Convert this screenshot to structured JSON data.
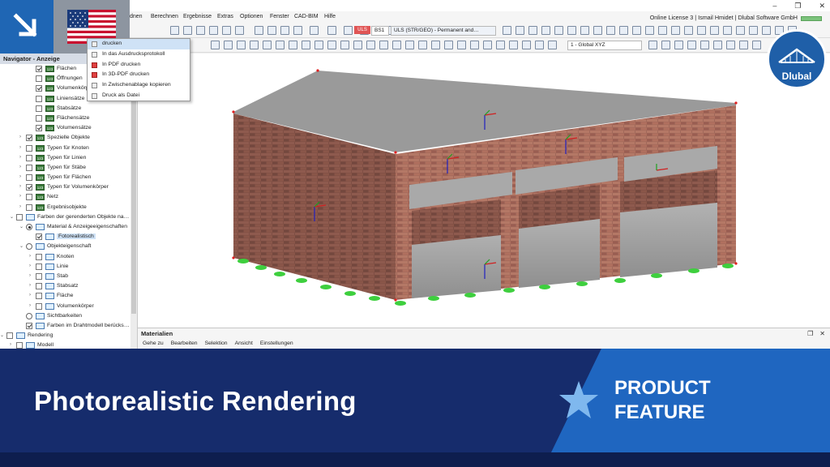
{
  "menu": {
    "items": [
      "dnen",
      "Berechnen",
      "Ergebnisse",
      "Extras",
      "Optionen",
      "Fenster",
      "CAD-BIM",
      "Hilfe"
    ]
  },
  "title_info": "Online License 3 | Ismail Hmidet | Dlubal Software GmbH",
  "toolbar": {
    "load_combo_badge": "ULS",
    "load_combo_id": "BS1",
    "load_combo_label": "ULS (STR/GEO) - Permanent and…",
    "coord_system": "1 - Global XYZ"
  },
  "dropdown": {
    "items": [
      {
        "label": "drucken",
        "selected": true
      },
      {
        "label": "In das Ausdrucksprotokoll",
        "selected": false
      },
      {
        "label": "In PDF drucken",
        "selected": false,
        "icon": "pdf-icon"
      },
      {
        "label": "In 3D-PDF drucken",
        "selected": false,
        "icon": "pdf-icon"
      },
      {
        "label": "In Zwischenablage kopieren",
        "selected": false
      },
      {
        "label": "Druck als Datei",
        "selected": false
      }
    ]
  },
  "navigator": {
    "title": "Navigator - Anzeige",
    "rows": [
      {
        "indent": 3,
        "exp": "",
        "ctrl": "cb",
        "checked": true,
        "icon": "123",
        "label": "Flächen"
      },
      {
        "indent": 3,
        "exp": "",
        "ctrl": "cb",
        "checked": false,
        "icon": "123",
        "label": "Öffnungen"
      },
      {
        "indent": 3,
        "exp": "",
        "ctrl": "cb",
        "checked": true,
        "icon": "123",
        "label": "Volumenkörper"
      },
      {
        "indent": 3,
        "exp": "",
        "ctrl": "cb",
        "checked": false,
        "icon": "123",
        "label": "Liniensätze"
      },
      {
        "indent": 3,
        "exp": "",
        "ctrl": "cb",
        "checked": false,
        "icon": "123",
        "label": "Stabsätze"
      },
      {
        "indent": 3,
        "exp": "",
        "ctrl": "cb",
        "checked": false,
        "icon": "123",
        "label": "Flächensätze"
      },
      {
        "indent": 3,
        "exp": "",
        "ctrl": "cb",
        "checked": true,
        "icon": "123",
        "label": "Volumensätze"
      },
      {
        "indent": 2,
        "exp": "›",
        "ctrl": "cb",
        "checked": true,
        "icon": "123",
        "label": "Spezielle Objekte"
      },
      {
        "indent": 2,
        "exp": "›",
        "ctrl": "cb",
        "checked": false,
        "icon": "123",
        "label": "Typen für Knoten"
      },
      {
        "indent": 2,
        "exp": "›",
        "ctrl": "cb",
        "checked": false,
        "icon": "123",
        "label": "Typen für Linien"
      },
      {
        "indent": 2,
        "exp": "›",
        "ctrl": "cb",
        "checked": false,
        "icon": "123",
        "label": "Typen für Stäbe"
      },
      {
        "indent": 2,
        "exp": "›",
        "ctrl": "cb",
        "checked": false,
        "icon": "123",
        "label": "Typen für Flächen"
      },
      {
        "indent": 2,
        "exp": "›",
        "ctrl": "cb",
        "checked": true,
        "icon": "123",
        "label": "Typen für Volumenkörper"
      },
      {
        "indent": 2,
        "exp": "›",
        "ctrl": "cb",
        "checked": false,
        "icon": "123",
        "label": "Netz"
      },
      {
        "indent": 2,
        "exp": "›",
        "ctrl": "cb",
        "checked": false,
        "icon": "123",
        "label": "Ergebnisobjekte"
      },
      {
        "indent": 1,
        "exp": "⌄",
        "ctrl": "cb",
        "checked": false,
        "icon": "brush",
        "label": "Farben der gerenderten Objekte na…"
      },
      {
        "indent": 2,
        "exp": "⌄",
        "ctrl": "rd",
        "checked": true,
        "icon": "brush",
        "label": "Material & Anzeigeeigenschaften"
      },
      {
        "indent": 3,
        "exp": "",
        "ctrl": "cb",
        "checked": true,
        "icon": "brush",
        "label": "Fotorealistisch",
        "highlight": true
      },
      {
        "indent": 2,
        "exp": "⌄",
        "ctrl": "rd",
        "checked": false,
        "icon": "brush",
        "label": "Objekteigenschaft"
      },
      {
        "indent": 3,
        "exp": "›",
        "ctrl": "cb",
        "checked": false,
        "icon": "brush",
        "label": "Knoten"
      },
      {
        "indent": 3,
        "exp": "›",
        "ctrl": "cb",
        "checked": false,
        "icon": "brush",
        "label": "Linie"
      },
      {
        "indent": 3,
        "exp": "›",
        "ctrl": "cb",
        "checked": false,
        "icon": "brush",
        "label": "Stab"
      },
      {
        "indent": 3,
        "exp": "›",
        "ctrl": "cb",
        "checked": false,
        "icon": "brush",
        "label": "Stabsatz"
      },
      {
        "indent": 3,
        "exp": "›",
        "ctrl": "cb",
        "checked": false,
        "icon": "brush",
        "label": "Fläche"
      },
      {
        "indent": 3,
        "exp": "›",
        "ctrl": "cb",
        "checked": false,
        "icon": "brush",
        "label": "Volumenkörper"
      },
      {
        "indent": 2,
        "exp": "",
        "ctrl": "rd",
        "checked": false,
        "icon": "brush",
        "label": "Sichtbarkeiten"
      },
      {
        "indent": 2,
        "exp": "",
        "ctrl": "cb",
        "checked": true,
        "icon": "brush",
        "label": "Farben im Drahtmodell berücks…"
      },
      {
        "indent": 0,
        "exp": "⌄",
        "ctrl": "cb",
        "checked": false,
        "icon": "brush",
        "label": "Rendering"
      },
      {
        "indent": 1,
        "exp": "›",
        "ctrl": "cb",
        "checked": false,
        "icon": "brush",
        "label": "Modell"
      }
    ]
  },
  "materials": {
    "title": "Materialien",
    "menu": [
      "Gehe zu",
      "Bearbeiten",
      "Selektion",
      "Ansicht",
      "Einstellungen"
    ]
  },
  "banner": {
    "title": "Photorealistic Rendering",
    "tag_line1": "PRODUCT",
    "tag_line2": "FEATURE"
  },
  "brand": {
    "logo_text": "Dlubal"
  },
  "colors": {
    "banner_dark": "#162c6c",
    "banner_light": "#1f66c0",
    "brand_blue": "#1f5fa8",
    "accent": "#1f66b4"
  }
}
